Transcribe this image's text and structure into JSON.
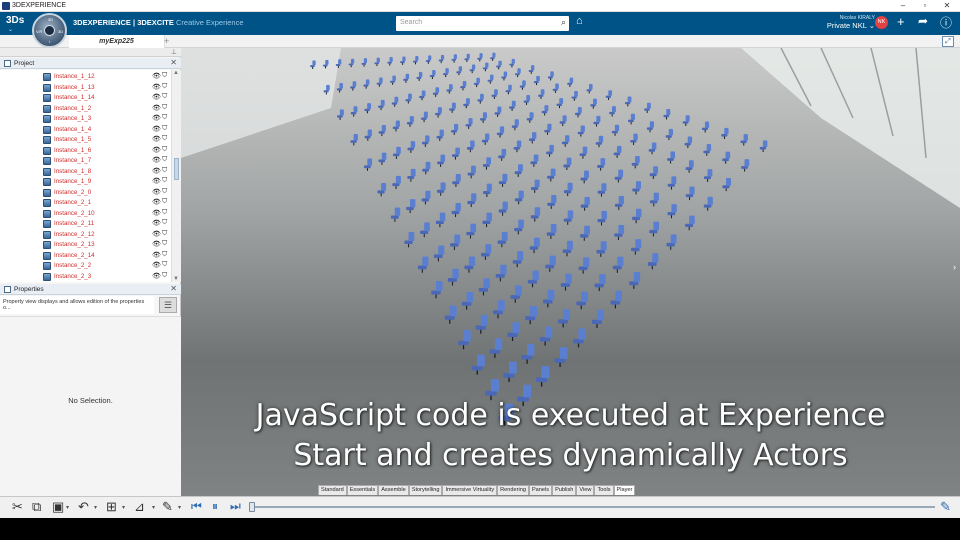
{
  "window": {
    "title": "3DEXPERIENCE"
  },
  "header": {
    "brand_main": "3DEXPERIENCE | 3DEXCITE",
    "brand_sub": "Creative Experience",
    "search_placeholder": "Search",
    "user_name": "Nicolas KIRALY",
    "workspace": "Private NKL",
    "avatar_initials": "NK",
    "compass_labels": {
      "top": "3D",
      "left": "V.R",
      "right": "3D",
      "bottom": "i"
    }
  },
  "tabs": {
    "active": "myExp225"
  },
  "project_panel": {
    "title": "Project",
    "items": [
      "Instance_1_12",
      "Instance_1_13",
      "Instance_1_14",
      "Instance_1_2",
      "Instance_1_3",
      "Instance_1_4",
      "Instance_1_5",
      "Instance_1_6",
      "Instance_1_7",
      "Instance_1_8",
      "Instance_1_9",
      "Instance_2_0",
      "Instance_2_1",
      "Instance_2_10",
      "Instance_2_11",
      "Instance_2_12",
      "Instance_2_13",
      "Instance_2_14",
      "Instance_2_2",
      "Instance_2_3"
    ]
  },
  "properties_panel": {
    "title": "Properties",
    "description": "Property view displays and allows edition of the properties o...",
    "empty_text": "No Selection."
  },
  "subtitle": {
    "line1": "JavaScript code is executed at Experience",
    "line2": "Start and creates dynamically Actors"
  },
  "workbench_tabs": [
    "Standard",
    "Essentials",
    "Assemble",
    "Storytelling",
    "Immersive Virtuality",
    "Rendering",
    "Panels",
    "Publish",
    "View",
    "Tools",
    "Player"
  ],
  "active_workbench": "Player",
  "colors": {
    "header": "#005386",
    "instance_label": "#d12b2b",
    "chair_blue": "#5b7fd0"
  }
}
